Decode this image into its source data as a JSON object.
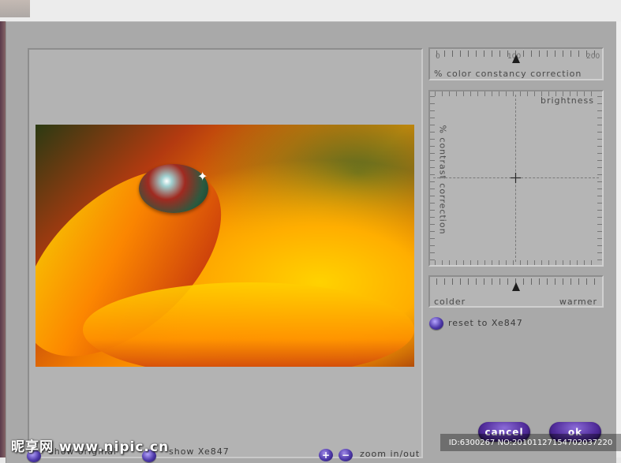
{
  "slider_color_constancy": {
    "label": "% color constancy correction",
    "min_label": "0",
    "mid_label": "100",
    "max_label": "200",
    "value": 100
  },
  "grid": {
    "top_label": "brightness",
    "side_label": "% contrast correction"
  },
  "slider_temperature": {
    "left_label": "colder",
    "right_label": "warmer",
    "value_fraction": 0.5
  },
  "reset": {
    "label": "reset to Xe847"
  },
  "bottom": {
    "show_original": "show original",
    "show_xe847": "show Xe847",
    "zoom_plus": "+",
    "zoom_minus": "−",
    "zoom_label": "zoom in/out"
  },
  "buttons": {
    "cancel": "cancel",
    "ok": "ok"
  },
  "watermark": {
    "logo": "昵享网 www.nipic.cn",
    "id_text": "ID:6300267 NO:20101127154702037220"
  },
  "colors": {
    "accent": "#4f2a98",
    "dialog_bg": "#a9a9a9",
    "panel_bg": "#b5b5b5"
  }
}
